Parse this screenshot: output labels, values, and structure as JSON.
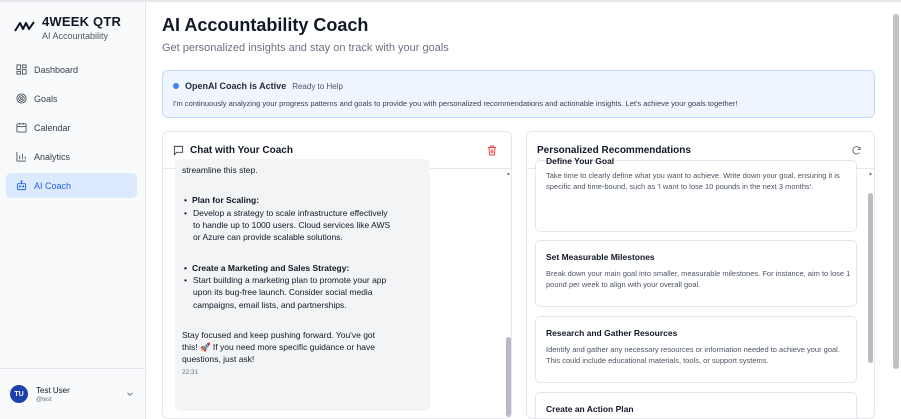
{
  "brand": {
    "title": "4WEEK QTR",
    "subtitle": "AI Accountability"
  },
  "sidebar": {
    "items": [
      {
        "label": "Dashboard",
        "icon": "grid-icon"
      },
      {
        "label": "Goals",
        "icon": "target-icon"
      },
      {
        "label": "Calendar",
        "icon": "calendar-icon"
      },
      {
        "label": "Analytics",
        "icon": "bar-chart-icon"
      },
      {
        "label": "AI Coach",
        "icon": "bot-icon",
        "active": true
      }
    ],
    "user": {
      "initials": "TU",
      "name": "Test User",
      "handle": "@test"
    }
  },
  "header": {
    "title": "AI Accountability Coach",
    "subtitle": "Get personalized insights and stay on track with your goals"
  },
  "banner": {
    "title": "OpenAI Coach is Active",
    "status": "Ready to Help",
    "text": "I'm continuously analyzing your progress patterns and goals to provide you with personalized recommendations and actionable insights. Let's achieve your goals together!"
  },
  "chat": {
    "title": "Chat with Your Coach",
    "message": {
      "lead": "streamline this step.",
      "sections": [
        {
          "heading": "Plan for Scaling:",
          "lines": [
            "Develop a strategy to scale infrastructure effectively",
            "to handle up to 1000 users. Cloud services like AWS",
            "or Azure can provide scalable solutions."
          ]
        },
        {
          "heading": "Create a Marketing and Sales Strategy:",
          "lines": [
            "Start building a marketing plan to promote your app",
            "upon its bug-free launch. Consider social media",
            "campaigns, email lists, and partnerships."
          ]
        }
      ],
      "closing": [
        "Stay focused and keep pushing forward. You've got",
        "this! 🚀 If you need more specific guidance or have",
        "questions, just ask!"
      ],
      "time": "22:31"
    }
  },
  "recommendations": {
    "title": "Personalized Recommendations",
    "items": [
      {
        "title": "Define Your Goal",
        "desc": "Take time to clearly define what you want to achieve. Write down your goal, ensuring it is specific and time-bound, such as 'I want to lose 10 pounds in the next 3 months'."
      },
      {
        "title": "Set Measurable Milestones",
        "desc": "Break down your main goal into smaller, measurable milestones. For instance, aim to lose 1 pound per week to align with your overall goal."
      },
      {
        "title": "Research and Gather Resources",
        "desc": "Identify and gather any necessary resources or information needed to achieve your goal. This could include educational materials, tools, or support systems."
      },
      {
        "title": "Create an Action Plan",
        "desc": ""
      }
    ]
  },
  "colors": {
    "accent": "#2563eb",
    "active_bg": "#dbeafe",
    "banner_bg": "#eff6ff",
    "danger": "#ef4444"
  }
}
